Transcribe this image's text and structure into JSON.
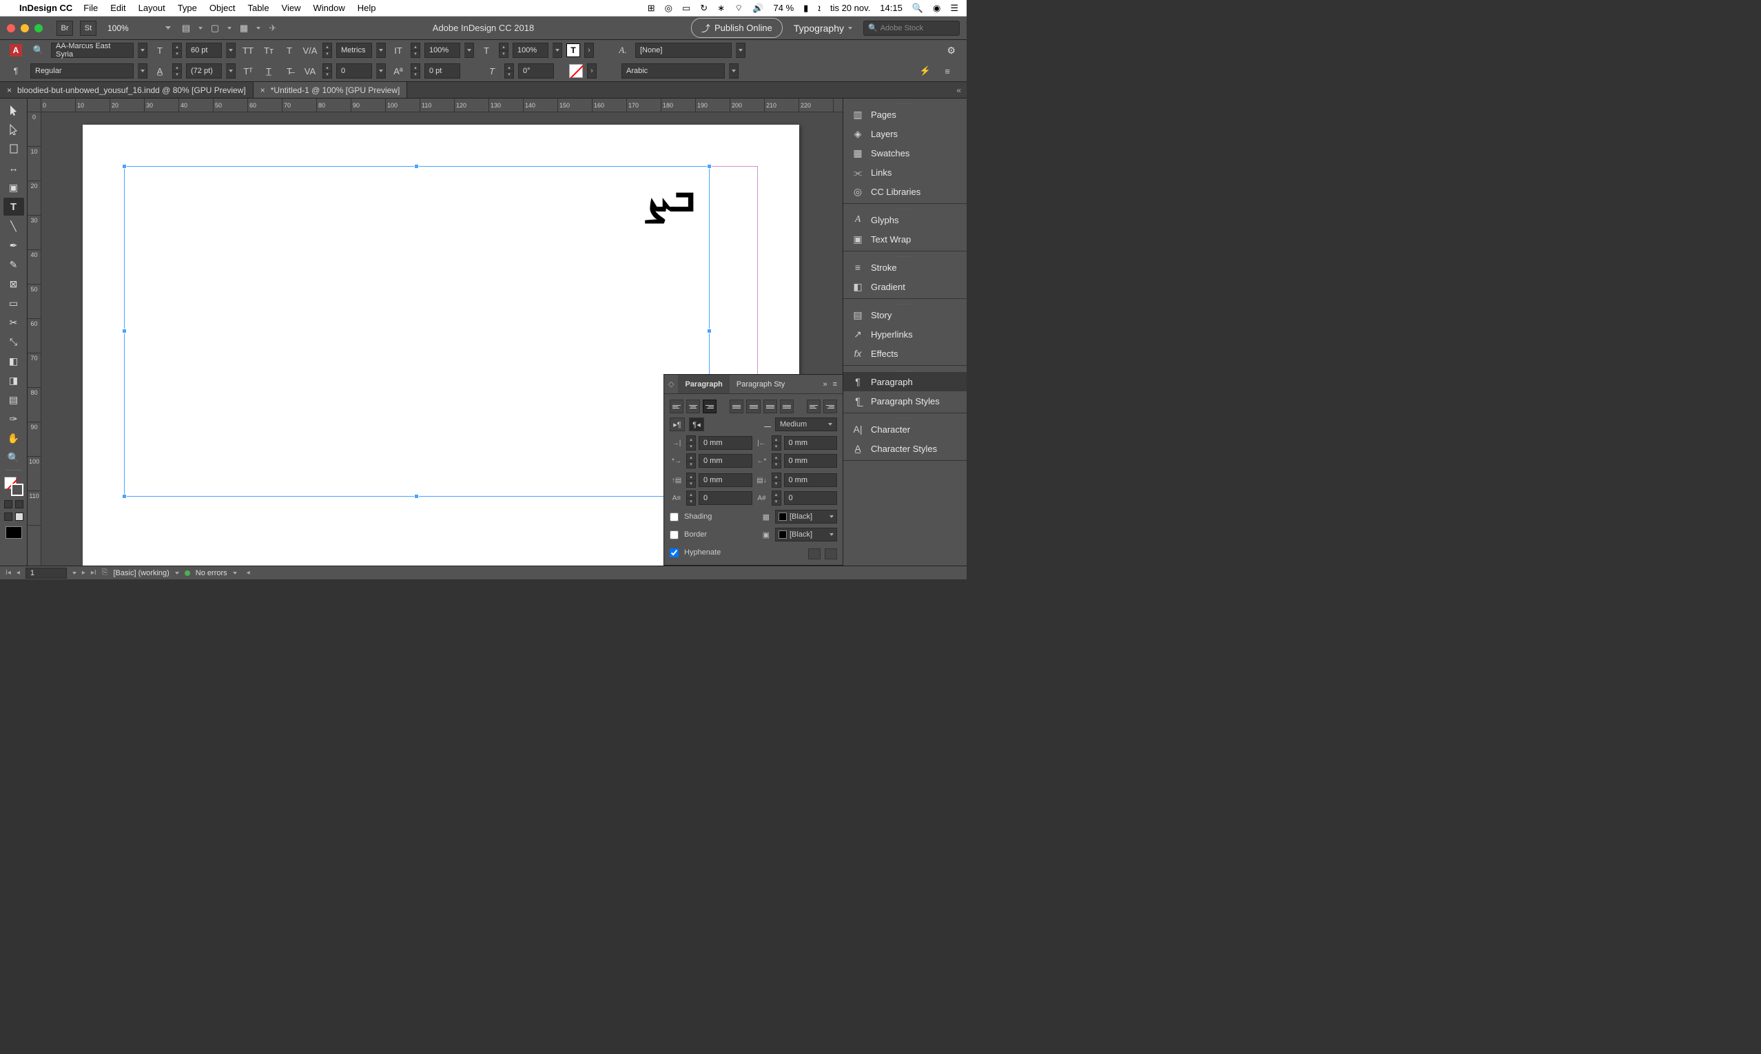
{
  "menubar": {
    "app": "InDesign CC",
    "items": [
      "File",
      "Edit",
      "Layout",
      "Type",
      "Object",
      "Table",
      "View",
      "Window",
      "Help"
    ],
    "battery": "74 %",
    "date": "tis 20 nov.",
    "time": "14:15"
  },
  "appbar": {
    "bridge": "Br",
    "stock": "St",
    "zoom": "100%",
    "doc_title": "Adobe InDesign CC 2018",
    "publish": "Publish Online",
    "workspace": "Typography",
    "search_placeholder": "Adobe Stock"
  },
  "control": {
    "font": "AA-Marcus East Syria",
    "style": "Regular",
    "size": "60 pt",
    "leading": "(72 pt)",
    "kerning": "Metrics",
    "tracking": "0",
    "hscale": "100%",
    "vscale": "100%",
    "baseline": "0 pt",
    "skew": "0°",
    "char_style": "[None]",
    "lang": "Arabic"
  },
  "tabs": [
    {
      "label": "bloodied-but-unbowed_yousuf_16.indd @ 80% [GPU Preview]",
      "active": false
    },
    {
      "label": "*Untitled-1 @ 100% [GPU Preview]",
      "active": true
    }
  ],
  "ruler_h": [
    "0",
    "10",
    "20",
    "30",
    "40",
    "50",
    "60",
    "70",
    "80",
    "90",
    "100",
    "110",
    "120",
    "130",
    "140",
    "150",
    "160",
    "170",
    "180",
    "190",
    "200",
    "210",
    "220"
  ],
  "ruler_v": [
    "0",
    "10",
    "20",
    "30",
    "40",
    "50",
    "60",
    "70",
    "80",
    "90",
    "100",
    "110"
  ],
  "sample_text": "ܒܨ",
  "paragraph_panel": {
    "tab1": "Paragraph",
    "tab2": "Paragraph Sty",
    "chevron": "◇",
    "kashida_label": "Medium",
    "indent_left": "0 mm",
    "indent_right": "0 mm",
    "first_left": "0 mm",
    "first_right": "0 mm",
    "space_before": "0 mm",
    "space_after": "0 mm",
    "drop_lines": "0",
    "drop_chars": "0",
    "shading_label": "Shading",
    "shading_swatch": "[Black]",
    "border_label": "Border",
    "border_swatch": "[Black]",
    "hyphenate_label": "Hyphenate"
  },
  "dock": {
    "groups": [
      [
        "Pages",
        "Layers",
        "Swatches",
        "Links",
        "CC Libraries"
      ],
      [
        "Glyphs",
        "Text Wrap"
      ],
      [
        "Stroke",
        "Gradient"
      ],
      [
        "Story",
        "Hyperlinks",
        "Effects"
      ],
      [
        "Paragraph",
        "Paragraph Styles"
      ],
      [
        "Character",
        "Character Styles"
      ]
    ],
    "active": "Paragraph"
  },
  "status": {
    "page": "1",
    "preflight_profile": "[Basic] (working)",
    "errors": "No errors"
  }
}
